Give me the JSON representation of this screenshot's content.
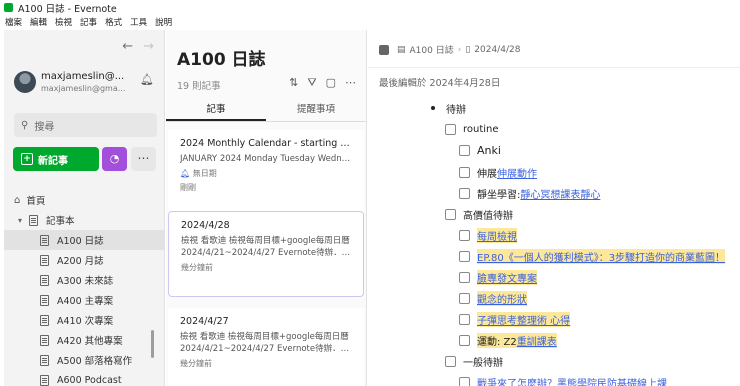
{
  "window": {
    "title": "A100 日誌 - Evernote"
  },
  "menu": [
    "檔案",
    "編輯",
    "檢視",
    "記事",
    "格式",
    "工具",
    "說明"
  ],
  "sidebar": {
    "account_name": "maxjameslin@...",
    "account_email": "maxjameslin@gma...",
    "search_placeholder": "搜尋",
    "new_note_label": "新記事",
    "tree": [
      {
        "label": "首頁",
        "kind": "home"
      },
      {
        "label": "記事本",
        "kind": "group"
      },
      {
        "label": "A100 日誌",
        "kind": "notebook",
        "selected": true
      },
      {
        "label": "A200 月誌",
        "kind": "notebook"
      },
      {
        "label": "A300 未來誌",
        "kind": "notebook"
      },
      {
        "label": "A400 主專案",
        "kind": "notebook"
      },
      {
        "label": "A410 次專案",
        "kind": "notebook"
      },
      {
        "label": "A420 其他專案",
        "kind": "notebook"
      },
      {
        "label": "A500 部落格寫作",
        "kind": "notebook"
      },
      {
        "label": "A600 Podcast",
        "kind": "notebook"
      }
    ]
  },
  "notelist": {
    "title": "A100 日誌",
    "count": "19 則記事",
    "tabs": [
      "記事",
      "提醒事項"
    ],
    "cards": [
      {
        "title": "2024 Monthly Calendar - starting Mo...",
        "snippet": "JANUARY 2024 Monday Tuesday Wedne...",
        "reminder": "無日期",
        "meta": "剛剛"
      },
      {
        "title": "2024/4/28",
        "snippet1": "檢視 看歌迪 檢視每周目標+google每周日曆",
        "snippet2": "2024/4/21~2024/4/27 Evernote待辦．收...",
        "meta": "幾分鐘前"
      },
      {
        "title": "2024/4/27",
        "snippet1": "檢視 看歌迪 檢視每周目標+google每周日曆",
        "snippet2": "2024/4/21~2024/4/27 Evernote待辦．收...",
        "meta": "幾分鐘前"
      }
    ]
  },
  "editor": {
    "breadcrumb_notebook": "A100 日誌",
    "breadcrumb_note": "2024/4/28",
    "last_edited": "最後編輯於 2024年4月28日",
    "bullet": "待辦",
    "routine": "routine",
    "anki": "Anki",
    "stretch_prefix": "伸展",
    "stretch_link": "伸展動作",
    "meditate_prefix": "靜坐學習:",
    "meditate_link": "靜心冥想課表靜心",
    "high_value": "高價值待辦",
    "weekly_review": "每周檢視",
    "ep80": "EP.80《一個人的獲利模式》：3步驟打造你的商業藍圖！",
    "blog": "臉專發文專案",
    "concept": "觀念的形狀",
    "subtitle": "子彈思考整理術 心得",
    "exercise_prefix": "運動: Z2 ",
    "exercise_link": "重訓課表",
    "general": "一般待辦",
    "war": "戰爭來了怎麼辦？黑熊學院民防基礎線上課"
  }
}
